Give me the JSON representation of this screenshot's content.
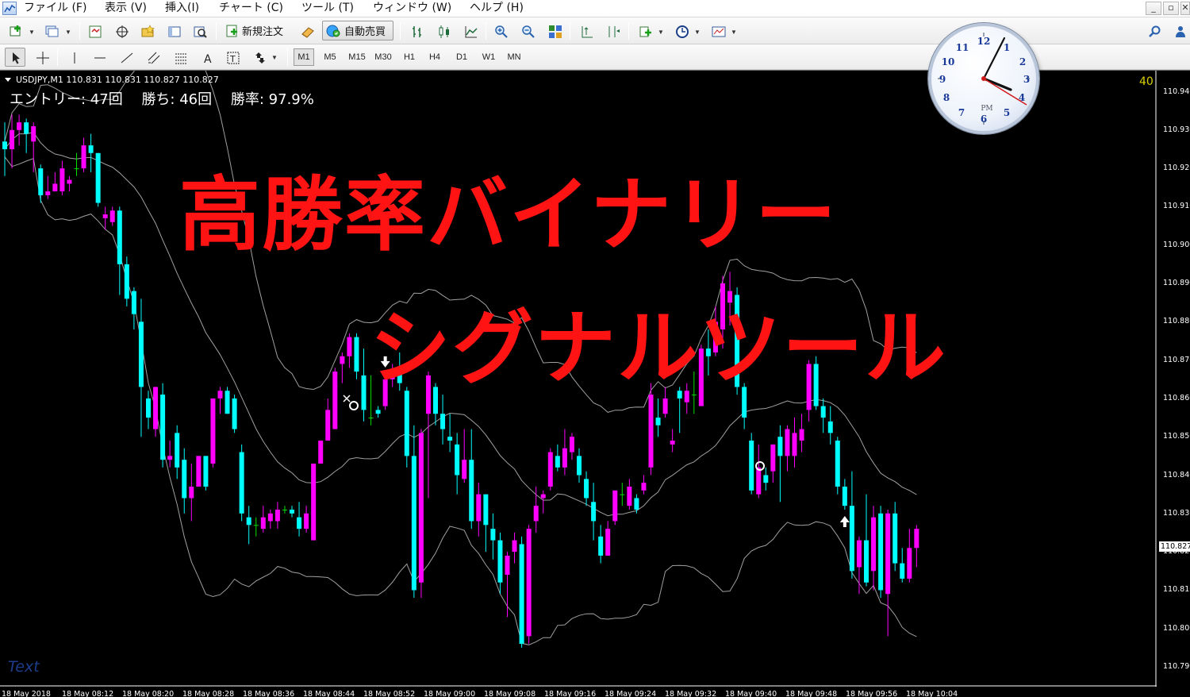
{
  "menu": {
    "items": [
      "ファイル (F)",
      "表示 (V)",
      "挿入(I)",
      "チャート (C)",
      "ツール (T)",
      "ウィンドウ (W)",
      "ヘルプ (H)"
    ],
    "window_buttons": [
      "_",
      "▫",
      "✕"
    ]
  },
  "toolbar": {
    "new_order_label": "新規注文",
    "auto_trade_label": "自動売買",
    "timeframes": [
      "M1",
      "M5",
      "M15",
      "M30",
      "H1",
      "H4",
      "D1",
      "W1",
      "MN"
    ],
    "selected_timeframe": "M1",
    "icons": [
      "new-chart-icon",
      "profiles-icon",
      "market-watch-icon",
      "navigator-icon",
      "favorites-icon",
      "terminal-icon",
      "tester-icon",
      "new-order-icon",
      "metaeditor-icon",
      "auto-trade-icon",
      "bar-chart-icon",
      "candlestick-icon",
      "line-chart-icon",
      "zoom-in-icon",
      "zoom-out-icon",
      "tile-windows-icon",
      "auto-scroll-icon",
      "chart-shift-icon",
      "indicators-icon",
      "periods-icon",
      "templates-icon",
      "search-icon",
      "community-icon",
      "cursor-icon",
      "crosshair-icon",
      "vertical-line-icon",
      "horizontal-line-icon",
      "trendline-icon",
      "fibonacci-icon",
      "equidistant-channel-icon",
      "text-icon",
      "text-label-icon",
      "arrows-icon"
    ]
  },
  "chart": {
    "symbol_line": "USDJPY,M1  110.831 110.831 110.827 110.827",
    "stats": {
      "entries": "エントリー: 47回",
      "wins": "勝ち: 46回",
      "win_rate": "勝率: 97.9%"
    },
    "bar_count": "40",
    "headline_line1": "高勝率バイナリー",
    "headline_line2": "シグナルツール",
    "text_object": "Text",
    "current_price": "110.827",
    "price_ticks": [
      "110.940",
      "110.930",
      "110.920",
      "110.910",
      "110.900",
      "110.890",
      "110.880",
      "110.870",
      "110.860",
      "110.850",
      "110.840",
      "110.830",
      "110.820",
      "110.810",
      "110.800",
      "110.790"
    ],
    "time_ticks": [
      "18 May 2018",
      "18 May 08:12",
      "18 May 08:20",
      "18 May 08:28",
      "18 May 08:36",
      "18 May 08:44",
      "18 May 08:52",
      "18 May 09:00",
      "18 May 09:08",
      "18 May 09:16",
      "18 May 09:24",
      "18 May 09:32",
      "18 May 09:40",
      "18 May 09:48",
      "18 May 09:56",
      "18 May 10:04"
    ],
    "colors": {
      "bull": "#ff00ff",
      "bear": "#00ffff",
      "doji": "#00e000",
      "band": "#a0a0a0",
      "headline": "#ff1313",
      "background": "#000000"
    }
  },
  "chart_data": {
    "type": "candlestick",
    "symbol": "USDJPY",
    "timeframe": "M1",
    "ylim": [
      110.79,
      110.945
    ],
    "ohlc": [
      [
        110.927,
        110.932,
        110.918,
        110.925
      ],
      [
        110.925,
        110.934,
        110.92,
        110.93
      ],
      [
        110.93,
        110.934,
        110.926,
        110.932
      ],
      [
        110.932,
        110.933,
        110.924,
        110.929
      ],
      [
        110.927,
        110.932,
        110.919,
        110.931
      ],
      [
        110.92,
        110.921,
        110.911,
        110.913
      ],
      [
        110.913,
        110.918,
        110.912,
        110.914
      ],
      [
        110.914,
        110.919,
        110.914,
        110.916
      ],
      [
        110.914,
        110.922,
        110.913,
        110.92
      ],
      [
        110.916,
        110.918,
        110.914,
        110.917
      ],
      [
        110.92,
        110.924,
        110.918,
        110.92
      ],
      [
        110.92,
        110.928,
        110.919,
        110.926
      ],
      [
        110.926,
        110.929,
        110.919,
        110.924
      ],
      [
        110.924,
        110.924,
        110.91,
        110.911
      ],
      [
        110.907,
        110.91,
        110.904,
        110.908
      ],
      [
        110.906,
        110.91,
        110.905,
        110.909
      ],
      [
        110.909,
        110.91,
        110.887,
        110.895
      ],
      [
        110.895,
        110.897,
        110.884,
        110.886
      ],
      [
        110.888,
        110.889,
        110.878,
        110.882
      ],
      [
        110.88,
        110.886,
        110.85,
        110.863
      ],
      [
        110.86,
        110.862,
        110.852,
        110.855
      ],
      [
        110.852,
        110.863,
        110.85,
        110.863
      ],
      [
        110.861,
        110.864,
        110.842,
        110.844
      ],
      [
        110.844,
        110.849,
        110.842,
        110.845
      ],
      [
        110.851,
        110.853,
        110.839,
        110.842
      ],
      [
        110.844,
        110.847,
        110.83,
        110.834
      ],
      [
        110.834,
        110.843,
        110.828,
        110.837
      ],
      [
        110.837,
        110.845,
        110.837,
        110.845
      ],
      [
        110.845,
        110.845,
        110.836,
        110.837
      ],
      [
        110.843,
        110.86,
        110.842,
        110.86
      ],
      [
        110.86,
        110.863,
        110.856,
        110.862
      ],
      [
        110.862,
        110.863,
        110.856,
        110.856
      ],
      [
        110.86,
        110.861,
        110.851,
        110.852
      ],
      [
        110.846,
        110.848,
        110.828,
        110.83
      ],
      [
        110.829,
        110.832,
        110.822,
        110.827
      ],
      [
        110.827,
        110.829,
        110.824,
        110.827
      ],
      [
        110.826,
        110.832,
        110.825,
        110.829
      ],
      [
        110.828,
        110.831,
        110.826,
        110.83
      ],
      [
        110.828,
        110.833,
        110.826,
        110.831
      ],
      [
        110.831,
        110.832,
        110.83,
        110.831
      ],
      [
        110.831,
        110.832,
        110.829,
        110.83
      ],
      [
        110.829,
        110.833,
        110.824,
        110.826
      ],
      [
        110.826,
        110.832,
        110.825,
        110.83
      ],
      [
        110.823,
        110.843,
        110.823,
        110.843
      ],
      [
        110.843,
        110.849,
        110.843,
        110.849
      ],
      [
        110.849,
        110.86,
        110.849,
        110.857
      ],
      [
        110.852,
        110.868,
        110.852,
        110.867
      ],
      [
        110.869,
        110.872,
        110.864,
        110.871
      ],
      [
        110.871,
        110.877,
        110.868,
        110.876
      ],
      [
        110.876,
        110.877,
        110.865,
        110.867
      ],
      [
        110.866,
        110.873,
        110.854,
        110.857
      ],
      [
        110.855,
        110.866,
        110.853,
        110.855
      ],
      [
        110.857,
        110.858,
        110.855,
        110.856
      ],
      [
        110.858,
        110.866,
        110.857,
        110.865
      ],
      [
        110.865,
        110.869,
        110.863,
        110.867
      ],
      [
        110.867,
        110.872,
        110.862,
        110.864
      ],
      [
        110.862,
        110.863,
        110.842,
        110.845
      ],
      [
        110.845,
        110.853,
        110.808,
        110.81
      ],
      [
        110.812,
        110.852,
        110.808,
        110.851
      ],
      [
        110.856,
        110.867,
        110.834,
        110.866
      ],
      [
        110.863,
        110.864,
        110.853,
        110.856
      ],
      [
        110.856,
        110.861,
        110.848,
        110.852
      ],
      [
        110.85,
        110.856,
        110.846,
        110.849
      ],
      [
        110.848,
        110.851,
        110.835,
        110.84
      ],
      [
        110.839,
        110.852,
        110.838,
        110.844
      ],
      [
        110.844,
        110.852,
        110.826,
        110.828
      ],
      [
        110.828,
        110.838,
        110.824,
        110.835
      ],
      [
        110.835,
        110.835,
        110.82,
        110.827
      ],
      [
        110.826,
        110.83,
        110.818,
        110.823
      ],
      [
        110.823,
        110.825,
        110.809,
        110.812
      ],
      [
        110.814,
        110.82,
        110.803,
        110.819
      ],
      [
        110.82,
        110.825,
        110.817,
        110.823
      ],
      [
        110.822,
        110.824,
        110.795,
        110.796
      ],
      [
        110.798,
        110.827,
        110.796,
        110.826
      ],
      [
        110.828,
        110.837,
        110.825,
        110.832
      ],
      [
        110.834,
        110.836,
        110.83,
        110.835
      ],
      [
        110.837,
        110.847,
        110.836,
        110.846
      ],
      [
        110.845,
        110.848,
        110.841,
        110.842
      ],
      [
        110.842,
        110.852,
        110.84,
        110.847
      ],
      [
        110.846,
        110.851,
        110.844,
        110.85
      ],
      [
        110.845,
        110.847,
        110.838,
        110.84
      ],
      [
        110.839,
        110.841,
        110.832,
        110.834
      ],
      [
        110.833,
        110.838,
        110.823,
        110.828
      ],
      [
        110.824,
        110.827,
        110.817,
        110.819
      ],
      [
        110.819,
        110.828,
        110.819,
        110.826
      ],
      [
        110.828,
        110.836,
        110.827,
        110.836
      ],
      [
        110.835,
        110.838,
        110.832,
        110.835
      ],
      [
        110.832,
        110.839,
        110.831,
        110.837
      ],
      [
        110.834,
        110.835,
        110.83,
        110.831
      ],
      [
        110.836,
        110.84,
        110.835,
        110.838
      ],
      [
        110.842,
        110.864,
        110.84,
        110.861
      ],
      [
        110.855,
        110.86,
        110.85,
        110.853
      ],
      [
        110.856,
        110.863,
        110.855,
        110.86
      ],
      [
        110.848,
        110.852,
        110.846,
        110.849
      ],
      [
        110.862,
        110.863,
        110.851,
        110.86
      ],
      [
        110.859,
        110.864,
        110.856,
        110.862
      ],
      [
        110.861,
        110.867,
        110.856,
        110.861
      ],
      [
        110.858,
        110.874,
        110.858,
        110.873
      ],
      [
        110.873,
        110.878,
        110.866,
        110.871
      ],
      [
        110.872,
        110.884,
        110.871,
        110.88
      ],
      [
        110.878,
        110.892,
        110.873,
        110.89
      ],
      [
        110.885,
        110.893,
        110.879,
        110.888
      ],
      [
        110.887,
        110.889,
        110.861,
        110.863
      ],
      [
        110.863,
        110.864,
        110.852,
        110.855
      ],
      [
        110.849,
        110.851,
        110.835,
        110.836
      ],
      [
        110.835,
        110.848,
        110.834,
        110.842
      ],
      [
        110.84,
        110.842,
        110.836,
        110.838
      ],
      [
        110.841,
        110.848,
        110.838,
        110.848
      ],
      [
        110.85,
        110.853,
        110.833,
        110.845
      ],
      [
        110.845,
        110.853,
        110.841,
        110.852
      ],
      [
        110.845,
        110.855,
        110.842,
        110.851
      ],
      [
        110.849,
        110.856,
        110.846,
        110.852
      ],
      [
        110.857,
        110.87,
        110.854,
        110.869
      ],
      [
        110.869,
        110.871,
        110.857,
        110.858
      ],
      [
        110.858,
        110.86,
        110.851,
        110.855
      ],
      [
        110.854,
        110.858,
        110.848,
        110.851
      ],
      [
        110.849,
        110.85,
        110.835,
        110.837
      ],
      [
        110.837,
        110.839,
        110.831,
        110.832
      ],
      [
        110.832,
        110.841,
        110.813,
        110.815
      ],
      [
        110.816,
        110.824,
        110.809,
        110.823
      ],
      [
        110.823,
        110.835,
        110.811,
        110.812
      ],
      [
        110.815,
        110.832,
        110.81,
        110.829
      ],
      [
        110.83,
        110.832,
        110.808,
        110.81
      ],
      [
        110.809,
        110.831,
        110.798,
        110.83
      ],
      [
        110.83,
        110.833,
        110.815,
        110.817
      ],
      [
        110.817,
        110.821,
        110.812,
        110.813
      ],
      [
        110.813,
        110.826,
        110.812,
        110.821
      ],
      [
        110.821,
        110.827,
        110.816,
        110.826
      ]
    ],
    "signals": [
      {
        "type": "sell-arrow",
        "bar": 53
      },
      {
        "type": "buy-arrow",
        "bar": 117
      }
    ]
  }
}
